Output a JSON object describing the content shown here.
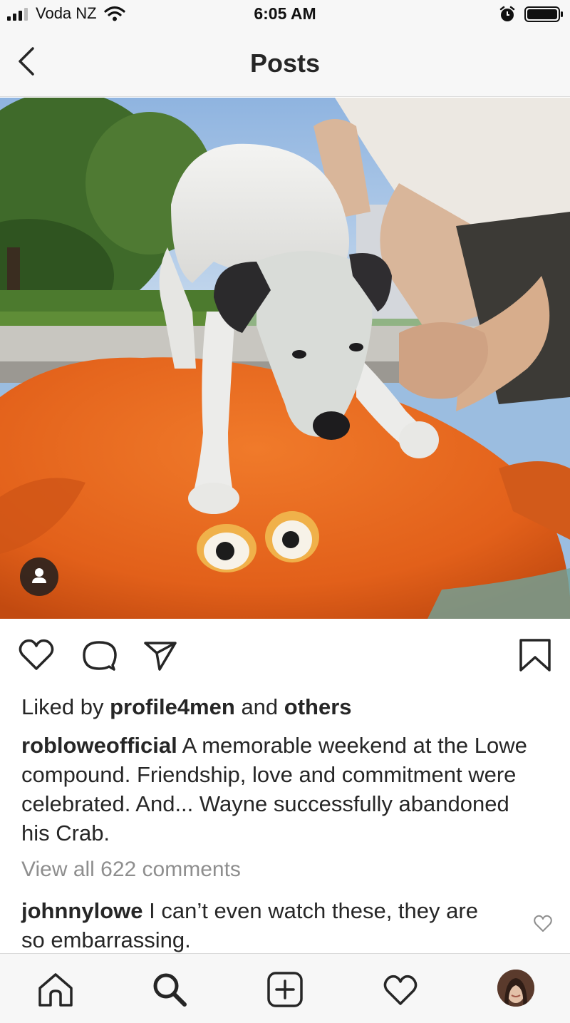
{
  "status_bar": {
    "carrier": "Voda NZ",
    "time": "6:05 AM",
    "icons": [
      "signal-icon",
      "wifi-icon",
      "alarm-icon",
      "battery-icon"
    ]
  },
  "nav": {
    "title": "Posts",
    "back_icon": "chevron-left-icon"
  },
  "post": {
    "image_subject": "dog on orange crab float",
    "tag_icon": "user-tag-icon",
    "actions": [
      "heart-icon",
      "comment-icon",
      "share-icon",
      "bookmark-icon"
    ],
    "likes": {
      "prefix": "Liked by",
      "user": "profile4men",
      "middle": "and",
      "others": "others"
    },
    "caption": {
      "username": "robloweofficial",
      "text": "A memorable weekend at the Lowe compound. Friendship, love and commitment were celebrated. And... Wayne successfully abandoned his Crab."
    },
    "view_comments": "View all 622 comments",
    "top_comment": {
      "username": "johnnylowe",
      "text": "I can’t even watch these, they are so embarrassing."
    }
  },
  "tab_bar": {
    "items": [
      "home-icon",
      "search-icon",
      "new-post-icon",
      "activity-icon",
      "profile-avatar"
    ]
  }
}
